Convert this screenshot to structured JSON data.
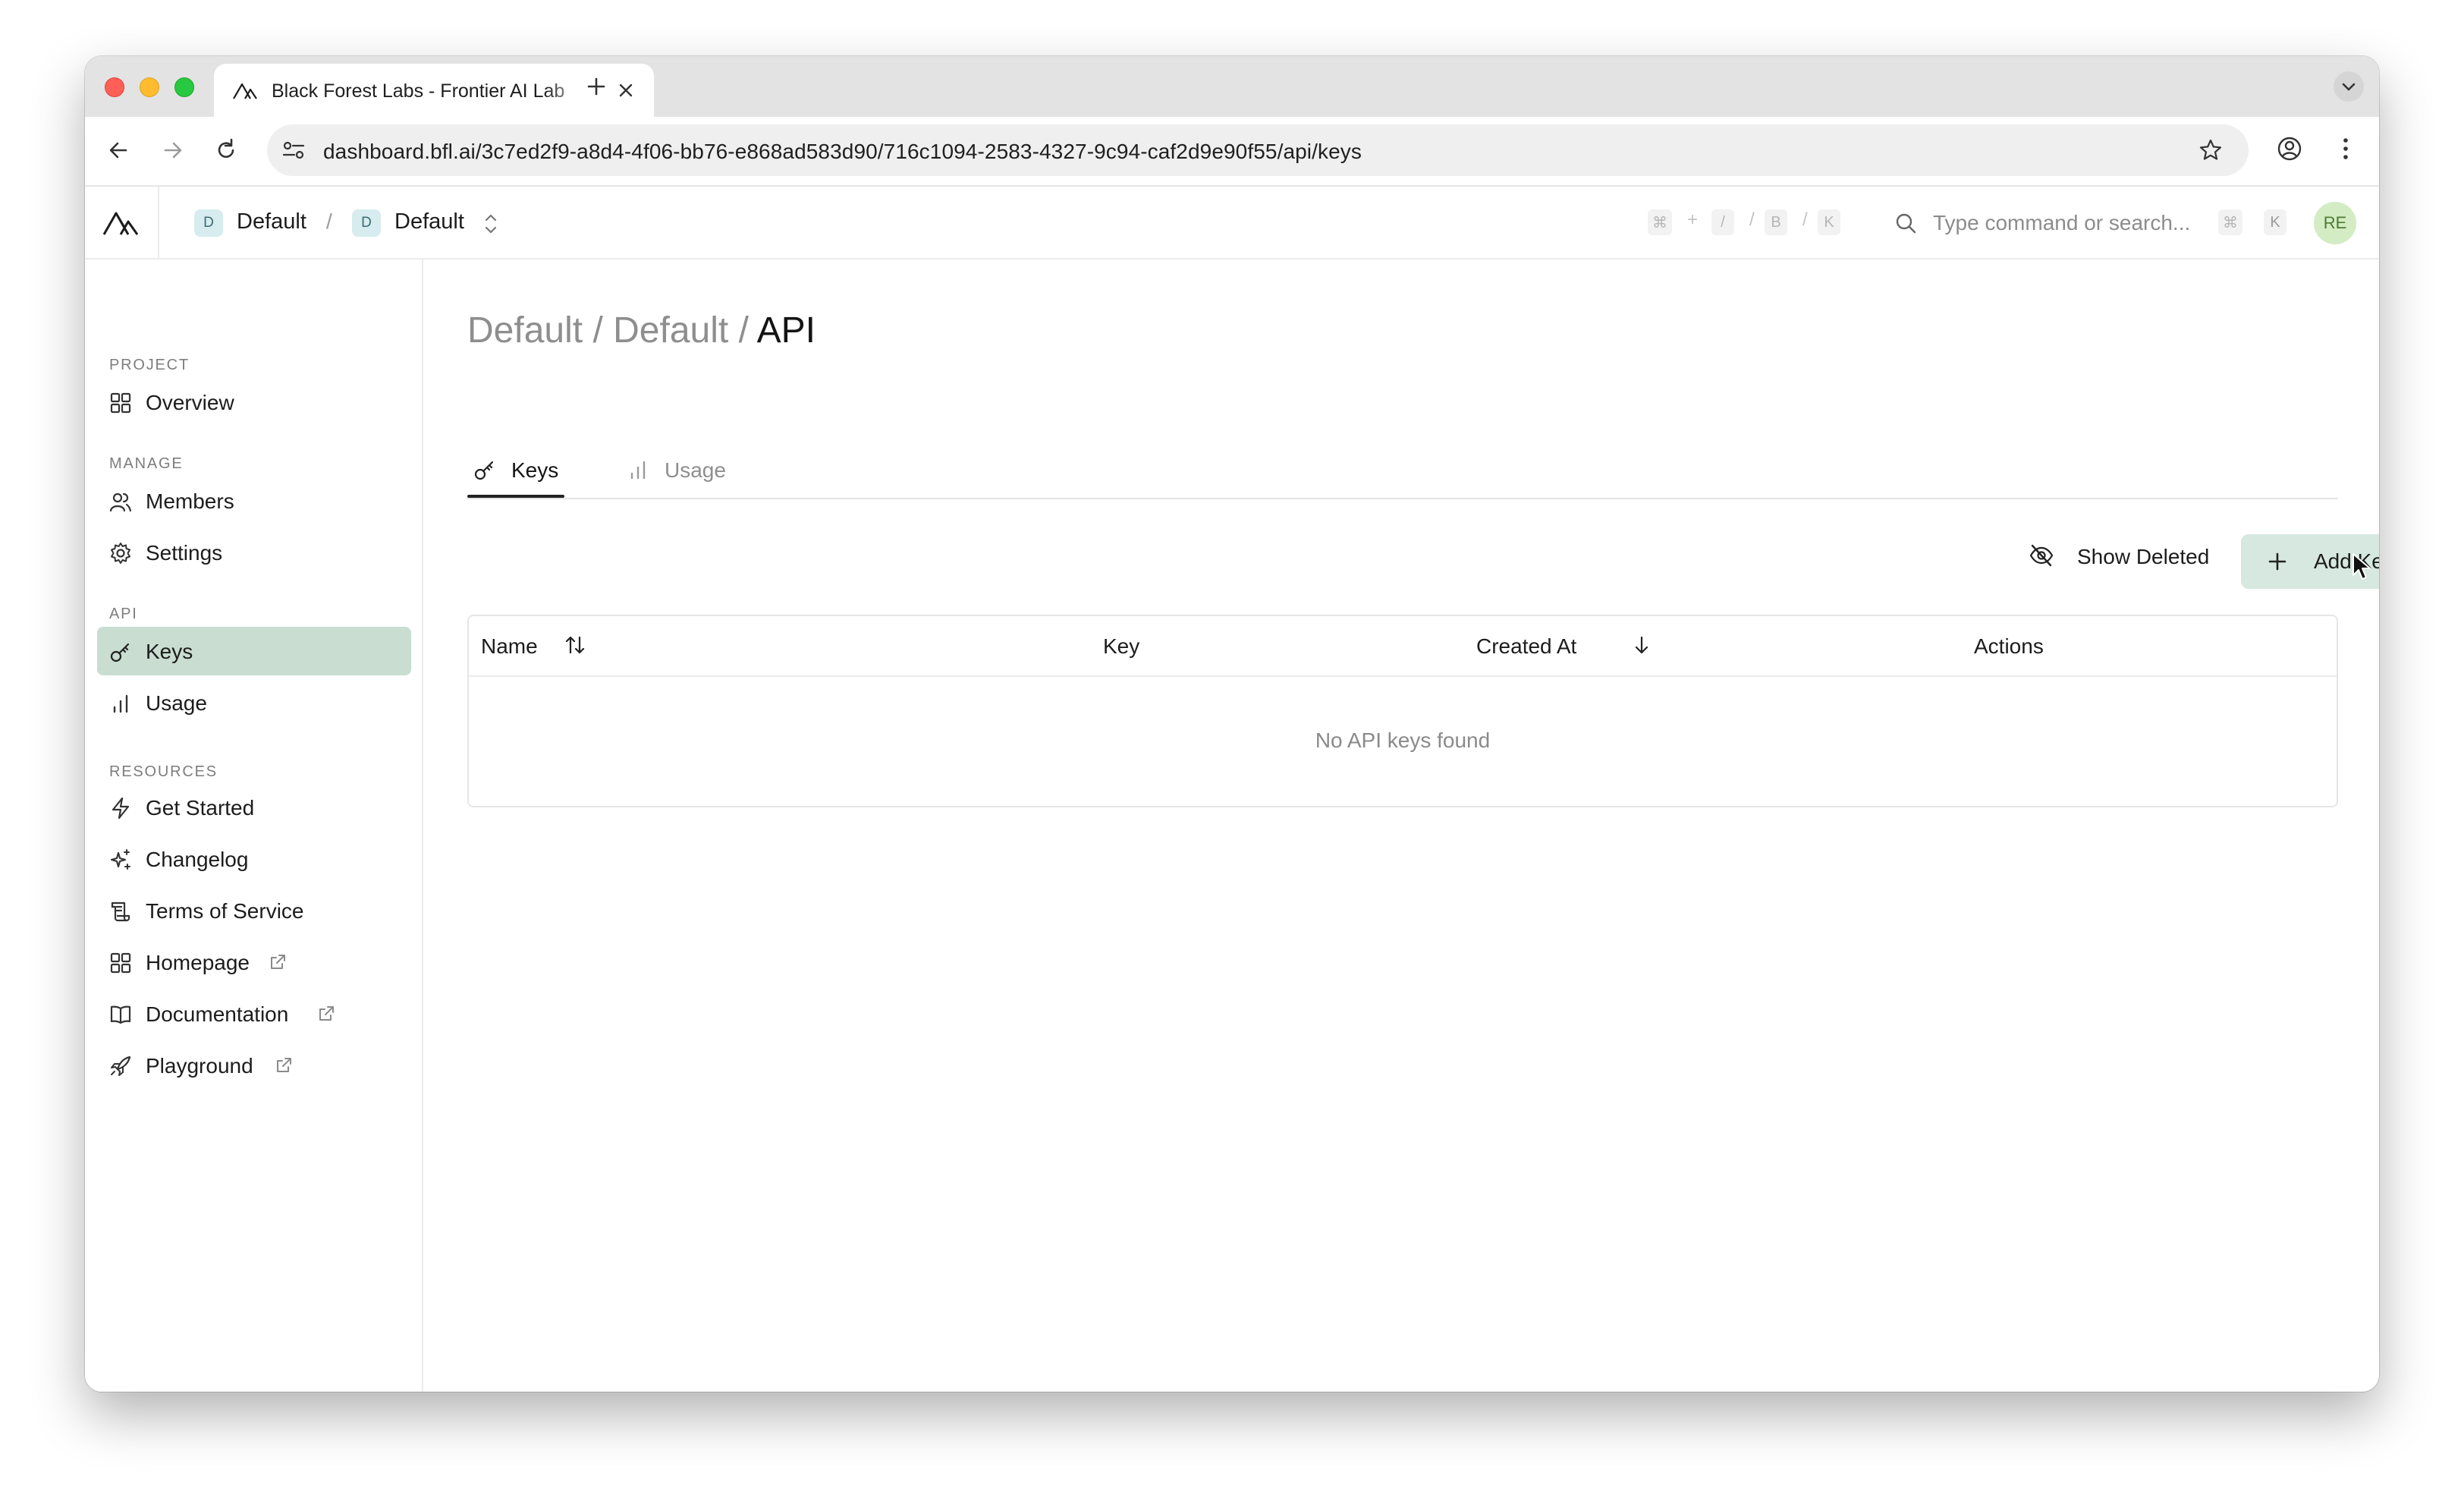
{
  "browser": {
    "tab_title": "Black Forest Labs - Frontier AI Lab",
    "url": "dashboard.bfl.ai/3c7ed2f9-a8d4-4f06-bb76-e868ad583d90/716c1094-2583-4327-9c94-caf2d9e90f55/api/keys"
  },
  "header": {
    "org_badge": "D",
    "org_name": "Default",
    "project_badge": "D",
    "project_name": "Default",
    "crumb_separator": "/",
    "shortcut_keys": [
      "⌘",
      "+",
      "/",
      "/",
      "B",
      "/",
      "K"
    ],
    "search_placeholder": "Type command or search...",
    "search_shortcut": [
      "⌘",
      "K"
    ],
    "avatar_initials": "RE"
  },
  "sidebar": {
    "sections": [
      {
        "label": "PROJECT",
        "items": [
          {
            "label": "Overview",
            "icon": "grid-icon"
          }
        ]
      },
      {
        "label": "MANAGE",
        "items": [
          {
            "label": "Members",
            "icon": "users-icon"
          },
          {
            "label": "Settings",
            "icon": "gear-icon"
          }
        ]
      },
      {
        "label": "API",
        "items": [
          {
            "label": "Keys",
            "icon": "key-icon",
            "active": true
          },
          {
            "label": "Usage",
            "icon": "bar-chart-icon"
          }
        ]
      },
      {
        "label": "RESOURCES",
        "items": [
          {
            "label": "Get Started",
            "icon": "bolt-icon"
          },
          {
            "label": "Changelog",
            "icon": "sparkles-icon"
          },
          {
            "label": "Terms of Service",
            "icon": "scroll-icon"
          },
          {
            "label": "Homepage",
            "icon": "grid-icon",
            "external": true
          },
          {
            "label": "Documentation",
            "icon": "book-icon",
            "external": true
          },
          {
            "label": "Playground",
            "icon": "rocket-icon",
            "external": true
          }
        ]
      }
    ]
  },
  "main": {
    "breadcrumb": [
      "Default",
      "Default",
      "API"
    ],
    "breadcrumb_separator": "/",
    "tabs": [
      {
        "label": "Keys",
        "active": true
      },
      {
        "label": "Usage",
        "active": false
      }
    ],
    "show_deleted_label": "Show Deleted",
    "add_key_label": "Add Key",
    "table": {
      "columns": [
        "Name",
        "Key",
        "Created At",
        "Actions"
      ],
      "empty_message": "No API keys found"
    }
  },
  "colors": {
    "active_nav_bg": "#c9ddd1",
    "primary_button_bg": "#d6e8df",
    "avatar_bg": "#d3ecc4"
  }
}
